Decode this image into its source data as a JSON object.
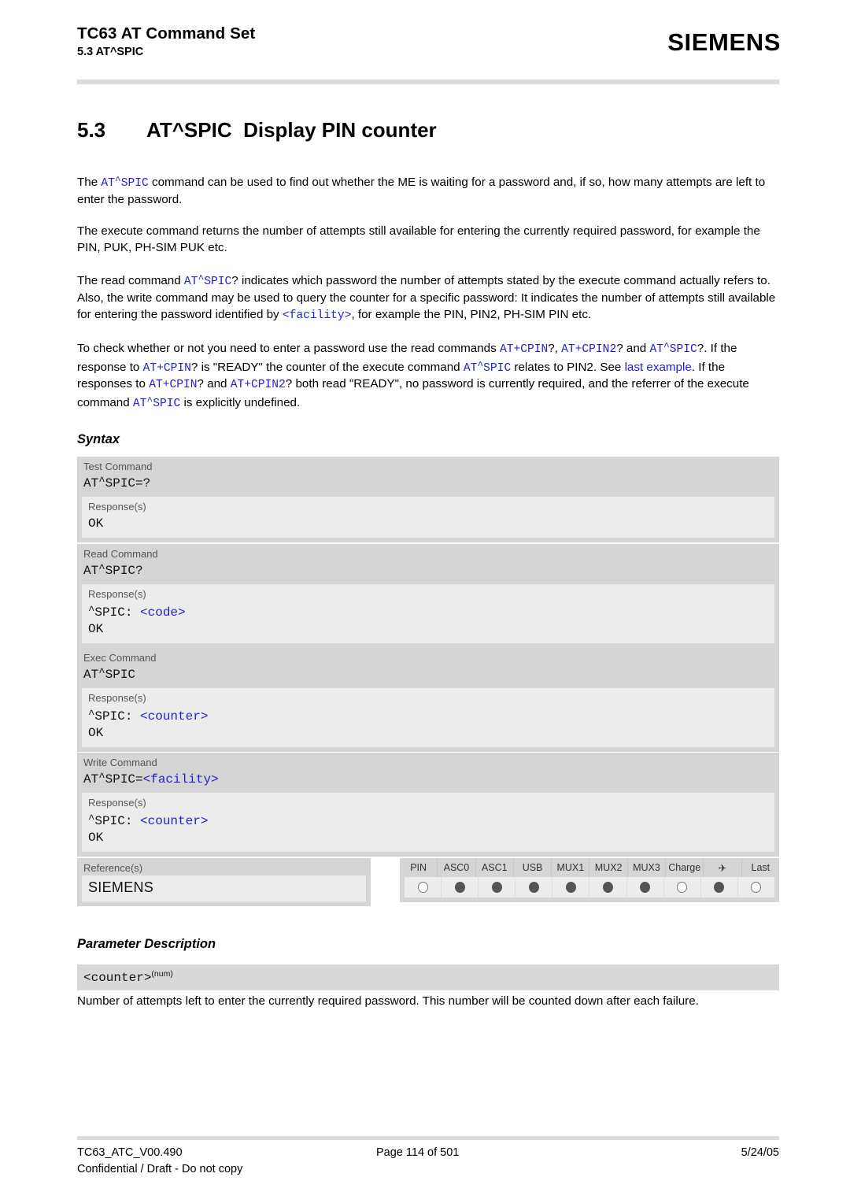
{
  "header": {
    "title": "TC63 AT Command Set",
    "subtitle": "5.3 AT^SPIC",
    "brand": "SIEMENS"
  },
  "section": {
    "number": "5.3",
    "command": "AT^SPIC",
    "title": "Display PIN counter"
  },
  "paragraphs": {
    "p1_a": "The ",
    "p1_cmd": "AT^SPIC",
    "p1_b": " command can be used to find out whether the ME is waiting for a password and, if so, how many attempts are left to enter the password.",
    "p2": "The execute command returns the number of attempts still available for entering the currently required password, for example the PIN, PUK, PH-SIM PUK etc.",
    "p3_a": "The read command ",
    "p3_cmd1": "AT^SPIC",
    "p3_b": "? indicates which password the number of attempts stated by the execute command actually refers to. Also, the write command may be used to query the counter for a specific password: It indicates the number of attempts still available for entering the password identified by ",
    "p3_cmd2": "<facility>",
    "p3_c": ", for example the PIN, PIN2, PH-SIM PIN etc.",
    "p4_a": "To check whether or not you need to enter a password use the read commands ",
    "p4_cmd1": "AT+CPIN",
    "p4_b": "?, ",
    "p4_cmd2": "AT+CPIN2",
    "p4_c": "? and ",
    "p4_cmd3": "AT^SPIC",
    "p4_d": "?. If the response to ",
    "p4_cmd4": "AT+CPIN",
    "p4_e": "? is \"READY\" the counter of the execute command ",
    "p4_cmd5": "AT^SPIC",
    "p4_f": " relates to PIN2. See ",
    "p4_link": "last example",
    "p4_g": ". If the responses to ",
    "p4_cmd6": "AT+CPIN",
    "p4_h": "? and ",
    "p4_cmd7": "AT+CPIN2",
    "p4_i": "? both read \"READY\", no password is currently required, and the referrer of the execute command ",
    "p4_cmd8": "AT^SPIC",
    "p4_j": " is explicitly undefined."
  },
  "syntax": {
    "heading": "Syntax",
    "response_label": "Response(s)",
    "blocks": [
      {
        "label": "Test Command",
        "cmd_pre": "AT",
        "cmd_caret": "^",
        "cmd_post": "SPIC=?",
        "cmd_param": "",
        "resp_line1_pre": "",
        "resp_line1_caret": "",
        "resp_line1_post": "",
        "resp_line1_param": "",
        "resp_ok": "OK"
      },
      {
        "label": "Read Command",
        "cmd_pre": "AT",
        "cmd_caret": "^",
        "cmd_post": "SPIC?",
        "cmd_param": "",
        "resp_line1_pre": "",
        "resp_line1_caret": "^",
        "resp_line1_post": "SPIC: ",
        "resp_line1_param": "<code>",
        "resp_ok": "OK"
      },
      {
        "label": "Exec Command",
        "cmd_pre": "AT",
        "cmd_caret": "^",
        "cmd_post": "SPIC",
        "cmd_param": "",
        "resp_line1_pre": "",
        "resp_line1_caret": "^",
        "resp_line1_post": "SPIC: ",
        "resp_line1_param": "<counter>",
        "resp_ok": "OK"
      },
      {
        "label": "Write Command",
        "cmd_pre": "AT",
        "cmd_caret": "^",
        "cmd_post": "SPIC=",
        "cmd_param": "<facility>",
        "resp_line1_pre": "",
        "resp_line1_caret": "^",
        "resp_line1_post": "SPIC: ",
        "resp_line1_param": "<counter>",
        "resp_ok": "OK"
      }
    ]
  },
  "references": {
    "label": "Reference(s)",
    "value": "SIEMENS"
  },
  "indicators": {
    "columns": [
      "PIN",
      "ASC0",
      "ASC1",
      "USB",
      "MUX1",
      "MUX2",
      "MUX3",
      "Charge",
      "airplane-icon",
      "Last"
    ],
    "column_labels": [
      "PIN",
      "ASC0",
      "ASC1",
      "USB",
      "MUX1",
      "MUX2",
      "MUX3",
      "Charge",
      "✈",
      "Last"
    ],
    "states": [
      "empty",
      "filled",
      "filled",
      "filled",
      "filled",
      "filled",
      "filled",
      "empty",
      "filled",
      "empty"
    ]
  },
  "parameter": {
    "heading": "Parameter Description",
    "name": "<counter>",
    "superscript": "(num)",
    "description": "Number of attempts left to enter the currently required password. This number will be counted down after each failure."
  },
  "footer": {
    "doc_id": "TC63_ATC_V00.490",
    "page": "Page 114 of 501",
    "date": "5/24/05",
    "confidential": "Confidential / Draft - Do not copy"
  },
  "colors": {
    "accent_blue": "#2222cc",
    "block_header_gray": "#d5d5d5",
    "block_body_gray": "#ececec",
    "rule_gray": "#dcdcdc"
  }
}
